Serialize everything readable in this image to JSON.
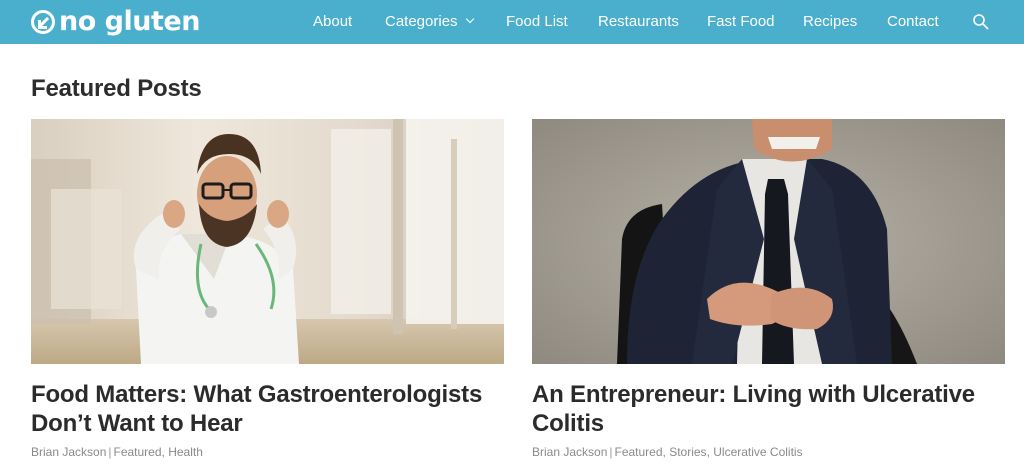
{
  "brand": {
    "logo_text": "no gluten"
  },
  "nav": {
    "items": [
      {
        "label": "About"
      },
      {
        "label": "Categories",
        "has_dropdown": true
      },
      {
        "label": "Food List"
      },
      {
        "label": "Restaurants"
      },
      {
        "label": "Fast Food"
      },
      {
        "label": "Recipes"
      },
      {
        "label": "Contact"
      }
    ],
    "search_icon": "search-icon"
  },
  "section": {
    "title": "Featured Posts"
  },
  "posts": [
    {
      "title_line1": "Food Matters: What Gastroenterologists",
      "title_line2": "Don’t Want to Hear",
      "author": "Brian Jackson",
      "categories": [
        "Featured",
        "Health"
      ]
    },
    {
      "title_line1": "An Entrepreneur: Living with Ulcerative",
      "title_line2": "Colitis",
      "author": "Brian Jackson",
      "categories": [
        "Featured",
        "Stories",
        "Ulcerative Colitis"
      ]
    }
  ],
  "colors": {
    "nav_background": "#4aafcc",
    "text": "#2b2b2b",
    "meta": "#8a8a8a"
  }
}
